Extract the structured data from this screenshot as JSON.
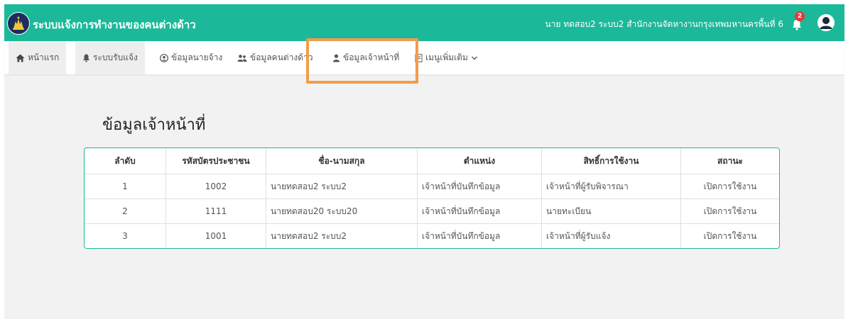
{
  "header": {
    "app_title": "ระบบแจ้งการทำงานของคนต่างด้าว",
    "user_info": "นาย ทดสอบ2  ระบบ2  สำนักงานจัดหางานกรุงเทพมหานครพื้นที่ 6",
    "notification_count": "2",
    "brand_color": "#1bb99a"
  },
  "nav": {
    "items": [
      {
        "label": "หน้าแรก",
        "icon": "home-icon"
      },
      {
        "label": "ระบบรับแจ้ง",
        "icon": "bell-icon"
      },
      {
        "label": "ข้อมูลนายจ้าง",
        "icon": "user-circle-icon"
      },
      {
        "label": "ข้อมูลคนต่างด้าว",
        "icon": "users-icon"
      },
      {
        "label": "ข้อมูลเจ้าหน้าที่",
        "icon": "user-icon"
      },
      {
        "label": "เมนูเพิ่มเติม",
        "icon": "document-icon"
      }
    ],
    "highlight_color": "#f39c4b"
  },
  "main": {
    "page_title": "ข้อมูลเจ้าหน้าที่",
    "table": {
      "headers": [
        "ลำดับ",
        "รหัสบัตรประชาชน",
        "ชื่อ-นามสกุล",
        "ตำแหน่ง",
        "สิทธิ์การใช้งาน",
        "สถานะ"
      ],
      "rows": [
        [
          "1",
          "1002",
          "นายทดสอบ2 ระบบ2",
          "เจ้าหน้าที่บันทึกข้อมูล",
          "เจ้าหน้าที่ผู้รับพิจารณา",
          "เปิดการใช้งาน"
        ],
        [
          "2",
          "1111",
          "นายทดสอบ20 ระบบ20",
          "เจ้าหน้าที่บันทึกข้อมูล",
          "นายทะเบียน",
          "เปิดการใช้งาน"
        ],
        [
          "3",
          "1001",
          "นายทดสอบ2 ระบบ2",
          "เจ้าหน้าที่บันทึกข้อมูล",
          "เจ้าหน้าที่ผู้รับแจ้ง",
          "เปิดการใช้งาน"
        ]
      ]
    }
  }
}
